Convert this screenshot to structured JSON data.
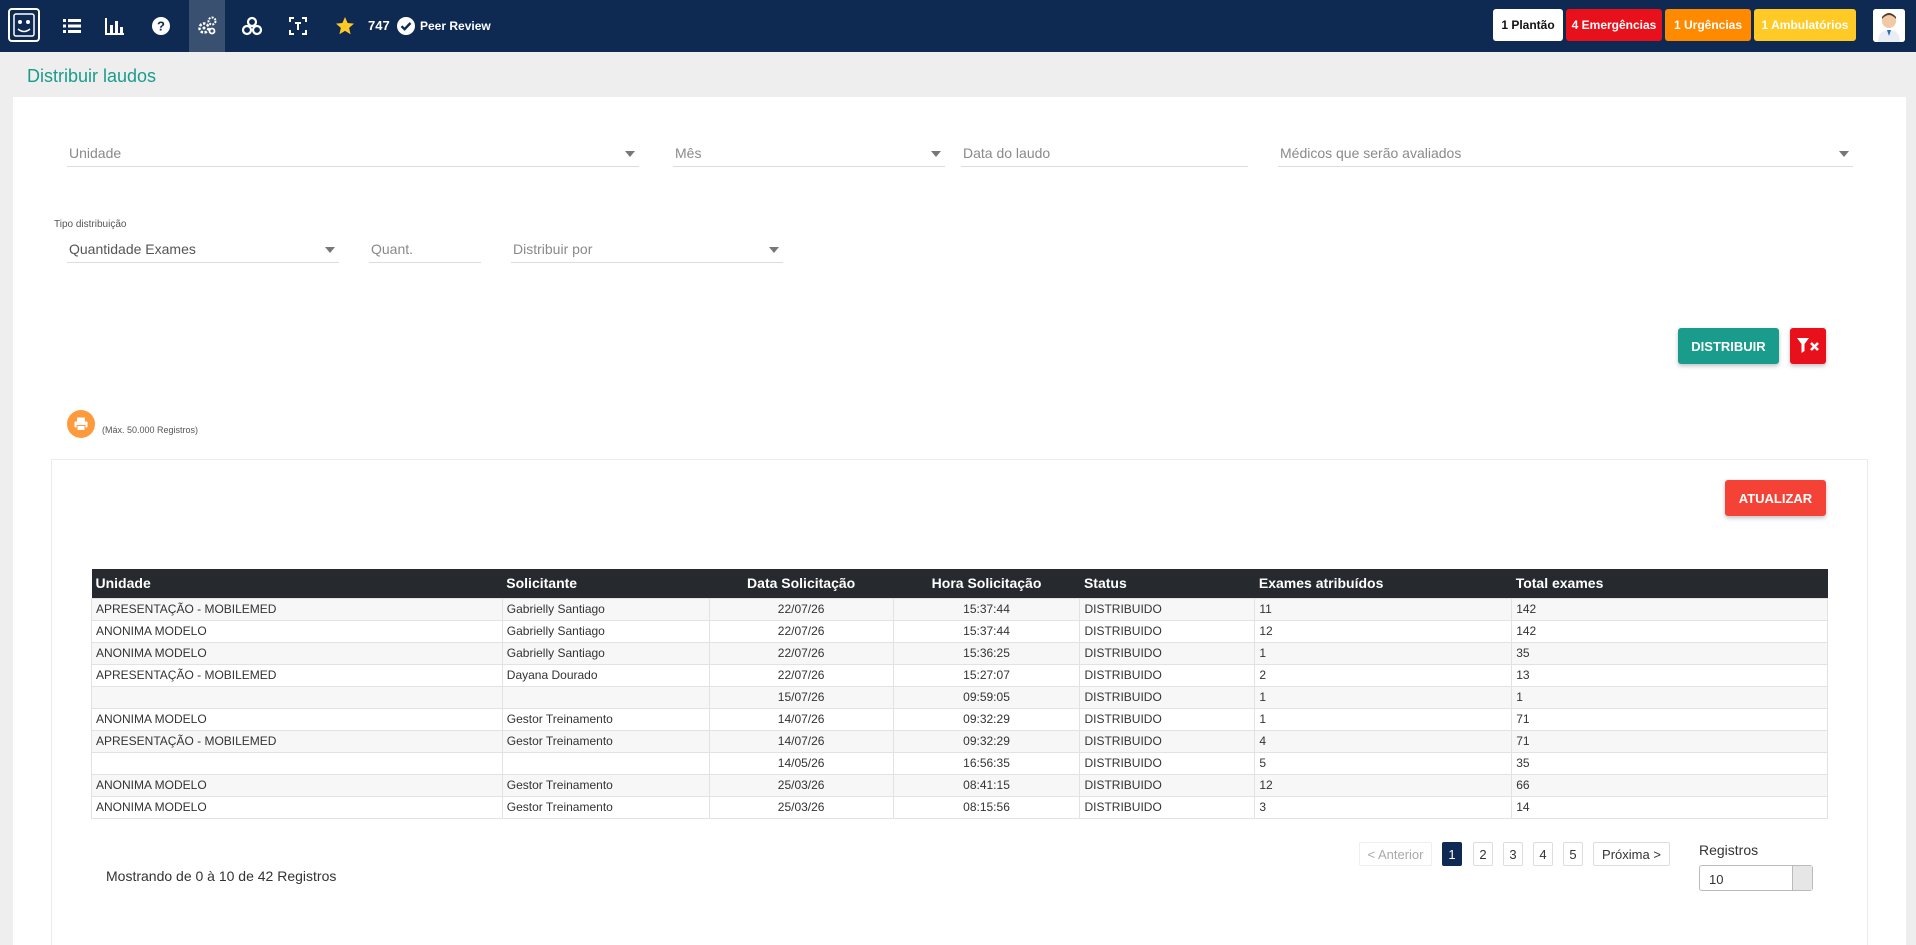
{
  "nav": {
    "peer_count": "747",
    "peer_label": "Peer Review",
    "icons": [
      "logo-icon",
      "list-icon",
      "chart-icon",
      "help-icon",
      "gears-icon",
      "cogs-icon",
      "scan-icon",
      "star-icon"
    ]
  },
  "badges": {
    "plantao": "1 Plantão",
    "emergencias": "4 Emergências",
    "urgencias": "1 Urgências",
    "ambulatorios": "1 Ambulatórios"
  },
  "colors": {
    "navbar": "#0e2a52",
    "accent": "#1a9c8c",
    "danger": "#f44336",
    "emergency": "#e8101a",
    "urgency": "#ff8a00",
    "ambulatory": "#ffc926",
    "print": "#ff9a3c"
  },
  "page": {
    "title": "Distribuir laudos"
  },
  "filters": {
    "unidade_placeholder": "Unidade",
    "mes_placeholder": "Mês",
    "data_laudo_placeholder": "Data do laudo",
    "medicos_placeholder": "Médicos que serão avaliados",
    "tipo_label": "Tipo distribuição",
    "tipo_value": "Quantidade Exames",
    "quant_placeholder": "Quant.",
    "distribuir_por_placeholder": "Distribuir por"
  },
  "actions": {
    "distribuir": "DISTRIBUIR",
    "atualizar": "ATUALIZAR",
    "print_note": "(Máx. 50.000 Registros)"
  },
  "table": {
    "headers": [
      "Unidade",
      "Solicitante",
      "Data Solicitação",
      "Hora Solicitação",
      "Status",
      "Exames atribuídos",
      "Total exames"
    ],
    "rows": [
      [
        "APRESENTAÇÃO - MOBILEMED",
        "Gabrielly Santiago",
        "22/07/26",
        "15:37:44",
        "DISTRIBUIDO",
        "11",
        "142"
      ],
      [
        "ANONIMA MODELO",
        "Gabrielly Santiago",
        "22/07/26",
        "15:37:44",
        "DISTRIBUIDO",
        "12",
        "142"
      ],
      [
        "ANONIMA MODELO",
        "Gabrielly Santiago",
        "22/07/26",
        "15:36:25",
        "DISTRIBUIDO",
        "1",
        "35"
      ],
      [
        "APRESENTAÇÃO - MOBILEMED",
        "Dayana Dourado",
        "22/07/26",
        "15:27:07",
        "DISTRIBUIDO",
        "2",
        "13"
      ],
      [
        "",
        "",
        "15/07/26",
        "09:59:05",
        "DISTRIBUIDO",
        "1",
        "1"
      ],
      [
        "ANONIMA MODELO",
        "Gestor Treinamento",
        "14/07/26",
        "09:32:29",
        "DISTRIBUIDO",
        "1",
        "71"
      ],
      [
        "APRESENTAÇÃO - MOBILEMED",
        "Gestor Treinamento",
        "14/07/26",
        "09:32:29",
        "DISTRIBUIDO",
        "4",
        "71"
      ],
      [
        "",
        "",
        "14/05/26",
        "16:56:35",
        "DISTRIBUIDO",
        "5",
        "35"
      ],
      [
        "ANONIMA MODELO",
        "Gestor Treinamento",
        "25/03/26",
        "08:41:15",
        "DISTRIBUIDO",
        "12",
        "66"
      ],
      [
        "ANONIMA MODELO",
        "Gestor Treinamento",
        "25/03/26",
        "08:15:56",
        "DISTRIBUIDO",
        "3",
        "14"
      ]
    ]
  },
  "footer": {
    "showing": "Mostrando de 0 à 10 de 42 Registros",
    "prev": "< Anterior",
    "pages": [
      "1",
      "2",
      "3",
      "4",
      "5"
    ],
    "next": "Próxima >",
    "registros_label": "Registros",
    "registros_value": "10"
  }
}
